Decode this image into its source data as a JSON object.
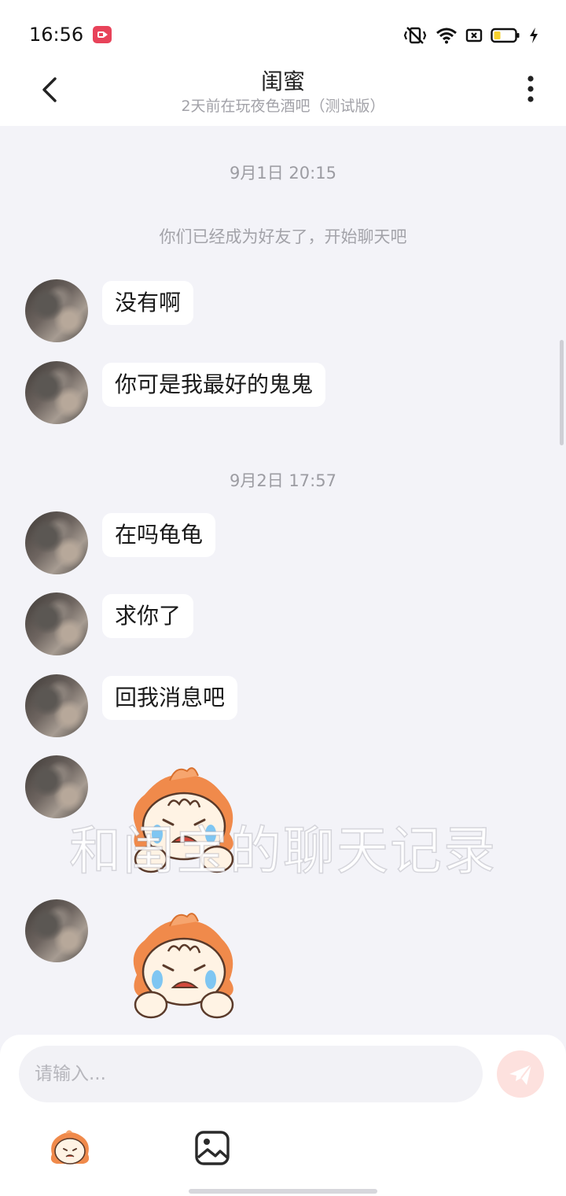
{
  "status_bar": {
    "time": "16:56",
    "icons": [
      "screen-record-icon",
      "vibrate-icon",
      "wifi-icon",
      "sim-icon",
      "battery-icon",
      "charging-icon"
    ]
  },
  "header": {
    "title": "闺蜜",
    "subtitle": "2天前在玩夜色酒吧（测试版）",
    "icons": [
      "back-icon",
      "more-icon"
    ]
  },
  "chat": {
    "timestamp_1": "9月1日 20:15",
    "system_message": "你们已经成为好友了，开始聊天吧",
    "msg_1": "没有啊",
    "msg_2": "你可是我最好的鬼鬼",
    "timestamp_2": "9月2日 17:57",
    "msg_3": "在吗龟龟",
    "msg_4": "求你了",
    "msg_5": "回我消息吧",
    "stickers": [
      "crying-mascot-sticker",
      "crying-mascot-sticker"
    ]
  },
  "overlay": {
    "watermark": "和闺宝的聊天记录"
  },
  "input": {
    "placeholder": "请输入...",
    "icons": [
      "send-icon",
      "emoji-icon",
      "image-icon"
    ]
  },
  "colors": {
    "background": "#f3f3f8",
    "bubble": "#ffffff",
    "send_button": "#fde1de",
    "accent": "#f08a4b"
  }
}
